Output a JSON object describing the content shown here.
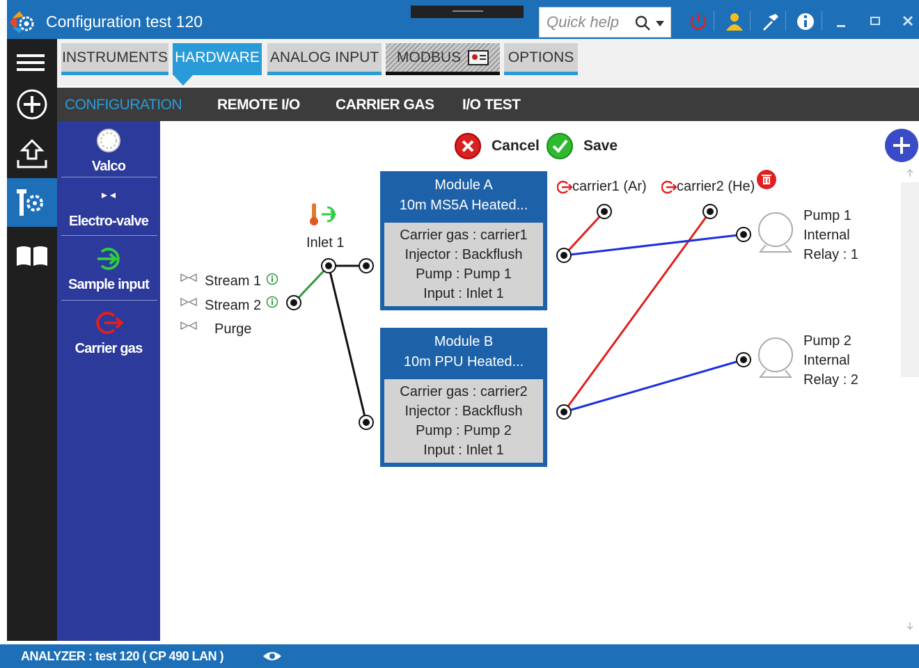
{
  "window": {
    "title": "Configuration test 120",
    "quick_help_placeholder": "Quick help"
  },
  "top_tabs": [
    {
      "label": "INSTRUMENTS",
      "active": false
    },
    {
      "label": "HARDWARE",
      "active": true
    },
    {
      "label": "ANALOG INPUT",
      "active": false
    },
    {
      "label": "MODBUS",
      "active": false,
      "disabled": true
    },
    {
      "label": "OPTIONS",
      "active": false
    }
  ],
  "sub_tabs": [
    {
      "label": "CONFIGURATION",
      "active": true
    },
    {
      "label": "REMOTE I/O",
      "active": false
    },
    {
      "label": "CARRIER GAS",
      "active": false
    },
    {
      "label": "I/O TEST",
      "active": false
    }
  ],
  "palette": [
    {
      "label": "Valco",
      "icon": "valco-icon"
    },
    {
      "label": "Electro-valve",
      "icon": "electro-valve-icon"
    },
    {
      "label": "Sample input",
      "icon": "sample-input-icon"
    },
    {
      "label": "Carrier gas",
      "icon": "carrier-gas-icon"
    }
  ],
  "actions": {
    "cancel": "Cancel",
    "save": "Save"
  },
  "streams": [
    "Stream 1",
    "Stream 2",
    "Purge"
  ],
  "inlet": {
    "label": "Inlet 1"
  },
  "carriers": [
    "carrier1 (Ar)",
    "carrier2 (He)"
  ],
  "modules": [
    {
      "title": "Module A",
      "subtitle": "10m MS5A Heated...",
      "carrier": "Carrier gas : carrier1",
      "injector": "Injector : Backflush",
      "pump": "Pump : Pump 1",
      "input": "Input : Inlet 1"
    },
    {
      "title": "Module B",
      "subtitle": "10m PPU Heated...",
      "carrier": "Carrier gas : carrier2",
      "injector": "Injector : Backflush",
      "pump": "Pump : Pump 2",
      "input": "Input : Inlet 1"
    }
  ],
  "pumps": [
    {
      "name": "Pump 1",
      "type": "Internal",
      "relay": "Relay : 1"
    },
    {
      "name": "Pump 2",
      "type": "Internal",
      "relay": "Relay : 2"
    }
  ],
  "status": {
    "text": "ANALYZER :  test 120 ( CP 490 LAN )"
  },
  "colors": {
    "title_bar": "#1d6fb8",
    "tab_accent": "#2a9bd9",
    "palette_bg": "#2b3a9b",
    "module_bg": "#1d61a8",
    "line_red": "#e02020",
    "line_blue": "#1a2fe0",
    "line_green": "#2e9a3a"
  }
}
